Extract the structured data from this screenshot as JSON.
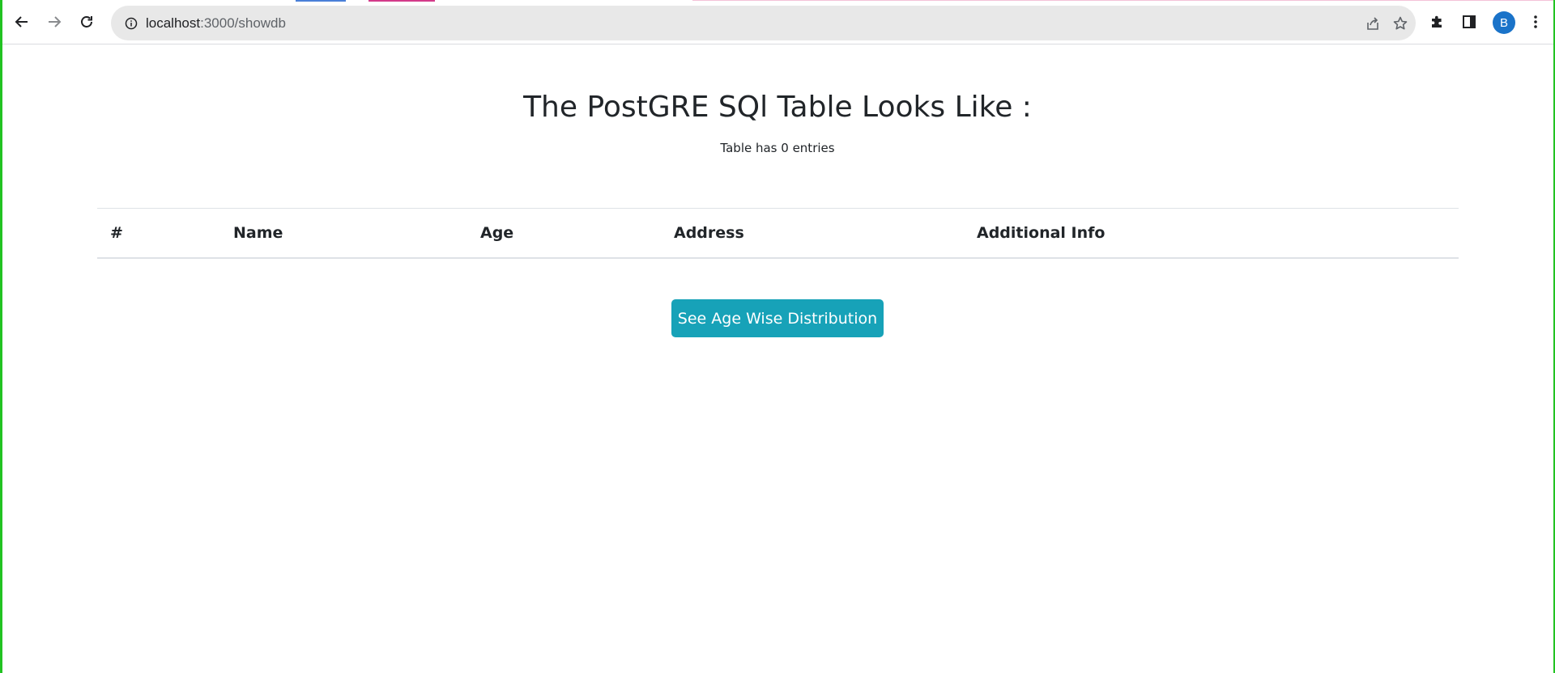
{
  "browser": {
    "url_host": "localhost",
    "url_path": ":3000/showdb",
    "avatar_letter": "B",
    "icons": {
      "back": "arrow-left-icon",
      "forward": "arrow-right-icon",
      "reload": "reload-icon",
      "site_info": "info-icon",
      "share": "share-icon",
      "bookmark": "star-icon",
      "extensions": "puzzle-icon",
      "side_panel": "side-panel-icon",
      "menu": "kebab-menu-icon"
    },
    "colors": {
      "omnibox_bg": "#e8e8e8",
      "avatar_bg": "#1a73c9"
    }
  },
  "page": {
    "title": "The PostGRE SQl Table Looks Like :",
    "entries_text": "Table has 0 entries",
    "table": {
      "columns": [
        "#",
        "Name",
        "Age",
        "Address",
        "Additional Info"
      ],
      "rows": []
    },
    "button_label": "See Age Wise Distribution",
    "colors": {
      "button_bg": "#17a2b8",
      "text": "#212529"
    }
  }
}
